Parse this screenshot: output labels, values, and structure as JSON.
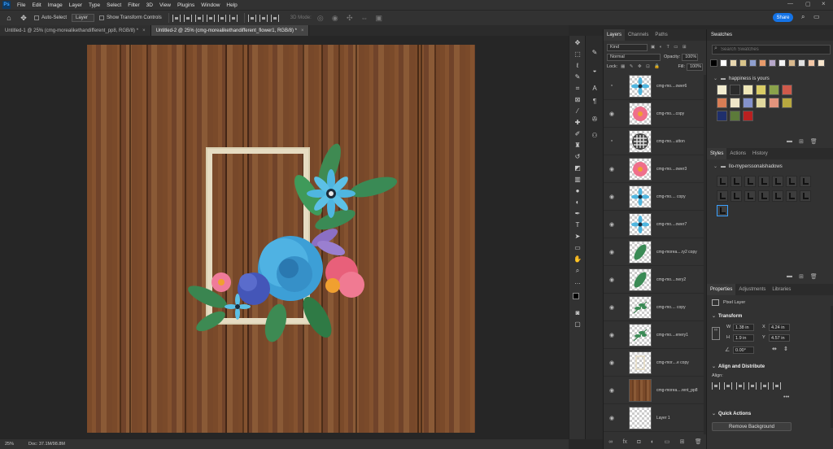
{
  "menubar": {
    "logo": "Ps",
    "items": [
      "File",
      "Edit",
      "Image",
      "Layer",
      "Type",
      "Select",
      "Filter",
      "3D",
      "View",
      "Plugins",
      "Window",
      "Help"
    ]
  },
  "options": {
    "auto_select": "Auto-Select",
    "layer_select": "Layer",
    "show_transform": "Show Transform Controls",
    "mode_3d": "3D Mode:",
    "share": "Share"
  },
  "tabs": [
    {
      "label": "Untitled-1 @ 25% (cmg-morealikethandifferent_pp8, RGB/8) *",
      "close": "×"
    },
    {
      "label": "Untitled-2 @ 25% (cmg-morealikethandifferent_flower1, RGB/8) *",
      "close": "×"
    }
  ],
  "status": {
    "zoom": "25%",
    "doc": "Doc: 37.1M/98.8M"
  },
  "layers_panel": {
    "tabs": [
      "Layers",
      "Channels",
      "Paths"
    ],
    "kind": "Kind",
    "blend_mode": "Normal",
    "opacity_label": "Opacity:",
    "opacity": "100%",
    "lock_label": "Lock:",
    "fill_label": "Fill:",
    "fill": "100%",
    "layers": [
      {
        "name": "cmg-mo....ower6",
        "visible": false,
        "thumb": "blue-flower"
      },
      {
        "name": "cmg-mo....copy",
        "visible": true,
        "thumb": "pink-flower"
      },
      {
        "name": "cmg-mo....utton",
        "visible": false,
        "thumb": "button"
      },
      {
        "name": "cmg-mo....ower3",
        "visible": true,
        "thumb": "pink-flower"
      },
      {
        "name": "cmg-mo.... copy",
        "visible": true,
        "thumb": "blue-flower"
      },
      {
        "name": "cmg-mo....ower7",
        "visible": true,
        "thumb": "blue-flower"
      },
      {
        "name": "cmg-morea....ry2 copy",
        "visible": true,
        "thumb": "leaf"
      },
      {
        "name": "cmg-mo....nery2",
        "visible": true,
        "thumb": "leaf"
      },
      {
        "name": "cmg-mo.... copy",
        "visible": true,
        "thumb": "sprig"
      },
      {
        "name": "cmg-mo....enery1",
        "visible": true,
        "thumb": "sprig"
      },
      {
        "name": "cmg-mor....e copy",
        "visible": true,
        "thumb": "frame"
      },
      {
        "name": "cmg-morea....rent_pp8",
        "visible": true,
        "thumb": "wood"
      },
      {
        "name": "Layer 1",
        "visible": true,
        "thumb": "empty"
      }
    ],
    "footer_icons": [
      "∞",
      "fx",
      "◘",
      "◐",
      "▭",
      "⊞",
      "🗑"
    ]
  },
  "swatches": {
    "title": "Swatches",
    "search_placeholder": "Search Swatches",
    "top_row": [
      "#000000",
      "#ffffff",
      "#e8d7b0",
      "#d9c48a",
      "#8fa0cf",
      "#e79b6b",
      "#b6a7c9",
      "#f4f4f4",
      "#d9b98d",
      "#e0e0e0",
      "#f3c7a6",
      "#f6e5cc"
    ],
    "folder_name": "happiness is yours",
    "folder_colors": [
      "#f2ecd0",
      "#2b2b2b",
      "#efe7b7",
      "#d9cc65",
      "#8aa24b",
      "#cf5a4b",
      "#d77d55",
      "#f0e6c9",
      "#8492cc",
      "#e0d79e",
      "#e2947d",
      "#b8a83f",
      "#1f2f6c",
      "#5c7a3a",
      "#b82020"
    ]
  },
  "styles": {
    "tabs": [
      "Styles",
      "Actions",
      "History"
    ],
    "folder_name": "llo-myperssonalshadows"
  },
  "properties": {
    "tabs": [
      "Properties",
      "Adjustments",
      "Libraries"
    ],
    "kind": "Pixel Layer",
    "transform_title": "Transform",
    "w_label": "W",
    "w": "1.38 in",
    "h_label": "H",
    "h": "1.9 in",
    "x_label": "X",
    "x": "4.24 in",
    "y_label": "Y",
    "y": "4.57 in",
    "angle": "0.00°",
    "align_title": "Align and Distribute",
    "align_label": "Align:",
    "quick_title": "Quick Actions",
    "remove_bg": "Remove Background"
  }
}
